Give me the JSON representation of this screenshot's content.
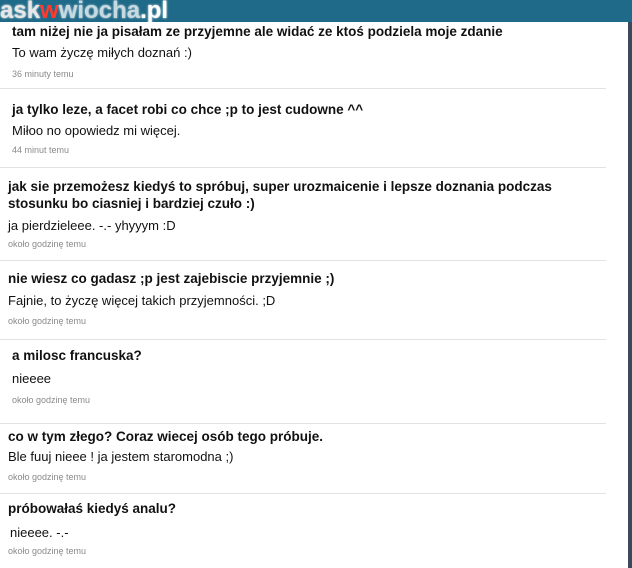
{
  "header": {
    "logo_prefix": "ask",
    "logo_w": "w",
    "logo_site": "wiocha",
    "logo_tld": ".pl"
  },
  "items": [
    {
      "question": "tam niżej nie ja pisałam ze przyjemne ale widać ze ktoś podziela moje zdanie",
      "answer": "To wam życzę miłych doznań :)",
      "time": "36 minuty temu"
    },
    {
      "question": "ja tylko leze, a facet robi co chce ;p to jest cudowne ^^",
      "answer": "Miłoo no opowiedz mi więcej.",
      "time": "44 minut temu"
    },
    {
      "question": "jak sie przemożesz kiedyś to spróbuj, super urozmaicenie i lepsze doznania podczas stosunku bo ciasniej i bardziej czuło :)",
      "answer": "ja pierdzieleee. -.- yhyyym :D",
      "time": "około godzinę temu"
    },
    {
      "question": "nie wiesz co gadasz ;p jest zajebiscie przyjemnie ;)",
      "answer": "Fajnie, to życzę więcej takich przyjemności. ;D",
      "time": "około godzinę temu"
    },
    {
      "question": "a milosc francuska?",
      "answer": "nieeee",
      "time": "około godzinę temu"
    },
    {
      "question": "co w tym złego? Coraz wiecej osób tego próbuje.",
      "answer": "Ble fuuj nieee ! ja jestem staromodna ;)",
      "time": "około godzinę temu"
    },
    {
      "question": "próbowałaś kiedyś analu?",
      "answer": "nieeee. -.-",
      "time": "około godzinę temu"
    }
  ]
}
